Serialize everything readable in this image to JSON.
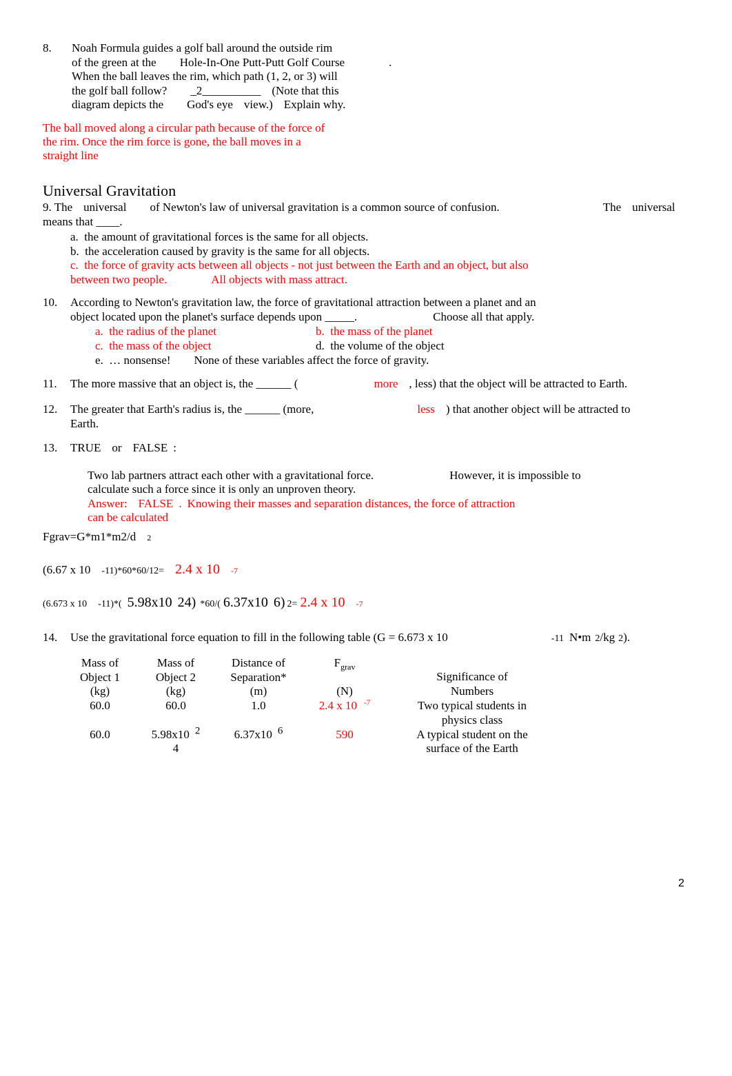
{
  "document": {
    "page_number": "2",
    "accent_red": "#FF0000",
    "text_color": "#000000"
  },
  "q8": {
    "number": "8.",
    "line1": "Noah Formula guides a golf ball around the outside rim",
    "line2a": "of the green at the",
    "line2b": "Hole-In-One Putt-Putt Golf Course",
    "line2c": ".",
    "line3": "When the ball leaves the rim, which path (1, 2, or 3) will",
    "line4a": "the golf ball follow?",
    "line4b": "_2__________",
    "line4c": "(Note that this",
    "line5a": "diagram depicts the",
    "line5b": "God's eye",
    "line5c": "view.)",
    "line5d": "Explain why.",
    "answer_line1": "The ball moved along a circular path because of the force of",
    "answer_line2": "the rim. Once the rim force is gone, the ball moves in a",
    "answer_line3": "straight line"
  },
  "heading": {
    "title": "Universal Gravitation"
  },
  "q9": {
    "line1a": "9. The",
    "line1b": "universal",
    "line1c": "of Newton's law of universal gravitation is a common source of confusion.",
    "line1d": "The",
    "line1e": "universal",
    "line2": "means that ____.",
    "option_a_label": "a.",
    "option_a_text": "the amount of gravitational forces is the same for all objects.",
    "option_b_label": "b.",
    "option_b_text": "the acceleration caused by gravity is the same for all objects.",
    "option_c_label": "c.",
    "option_c_text": "the force of gravity acts between all objects - not just between the Earth and an object, but also",
    "option_c_text2": "between two people.",
    "option_c_text3": "All objects with mass attract."
  },
  "q10": {
    "number": "10.",
    "line1": "According to Newton's gravitation law, the force of gravitational attraction between a planet and an",
    "line2a": "object located upon the planet's surface depends upon _____.",
    "line2b": "Choose all that apply.",
    "option_a_label": "a.",
    "option_a_text": "the radius of the planet",
    "option_b_label": "b.",
    "option_b_text": "the mass of the planet",
    "option_c_label": "c.",
    "option_c_text": "the mass of the object",
    "option_d_label": "d.",
    "option_d_text": "the volume of the object",
    "option_e_label": "e.",
    "option_e_text": "… nonsense!",
    "option_e_text2": "None of these variables affect the force of gravity."
  },
  "q11": {
    "number": "11.",
    "text_before": "The more massive that an object is, the ______ (",
    "answer": "more",
    "text_after": ", less) that the object will be attracted to Earth."
  },
  "q12": {
    "number": "12.",
    "text_before": "The greater that Earth's radius is, the ______ (more,",
    "answer": "less",
    "text_after": ") that another object will be attracted to",
    "text_wrap": "Earth."
  },
  "q13": {
    "number": "13.",
    "head_a": "TRUE",
    "head_b": "or",
    "head_c": "FALSE",
    "head_d": ":",
    "line1a": "Two lab partners attract each other with a gravitational force.",
    "line1b": "However, it is impossible to",
    "line2": "calculate such a force since it is only an unproven theory.",
    "answer_label": "Answer:",
    "answer_value": "FALSE",
    "answer_dot": ".",
    "answer_text": "Knowing their masses and separation distances, the force of attraction",
    "answer_text2": "can be calculated"
  },
  "formula": {
    "expr": "Fgrav=G*m1*m2/d",
    "exponent": "2"
  },
  "calc1": {
    "part1": "(6.67 x 10",
    "exp1": "-11)*60*60/12=",
    "result": "2.4 x 10",
    "result_exp": "-7"
  },
  "calc2": {
    "part1": "(6.673 x 10",
    "exp1": "-11)*(",
    "part2": "5.98x10",
    "exp2": "24)",
    "part3": "*60/(",
    "part4": "6.37x10",
    "exp3": "6)",
    "part5": "2=",
    "result": "2.4 x 10",
    "result_exp": "-7"
  },
  "q14": {
    "number": "14.",
    "text": "Use the gravitational force equation to fill in the following table (G = 6.673 x 10",
    "exp": "-11",
    "units_a": "N•m",
    "units_exp_a": "2",
    "units_b": "/kg",
    "units_exp_b": "2",
    "units_close": ")."
  },
  "table": {
    "headers": [
      {
        "l1": "Mass of",
        "l2": "Object 1",
        "l3": "(kg)"
      },
      {
        "l1": "Mass of",
        "l2": "Object 2",
        "l3": "(kg)"
      },
      {
        "l1": "Distance of",
        "l2": "Separation*",
        "l3": "(m)"
      },
      {
        "l1": "F",
        "sub": "grav",
        "l3": "(N)"
      },
      {
        "l1": "Significance of",
        "l2": "Numbers"
      }
    ],
    "rows": [
      {
        "m1": "60.0",
        "m2": "60.0",
        "m2_exp": "",
        "m2_exp_wrap": "",
        "d": "1.0",
        "d_exp": "",
        "f": "2.4 x 10",
        "f_exp": "-7",
        "sig_l1": "Two typical students in",
        "sig_l2": "physics class"
      },
      {
        "m1": "60.0",
        "m2": "5.98x10",
        "m2_exp": "2",
        "m2_exp_wrap": "4",
        "d": "6.37x10",
        "d_exp": "6",
        "f": "590",
        "f_exp": "",
        "sig_l1": "A typical student on the",
        "sig_l2": "surface of the Earth"
      }
    ]
  }
}
